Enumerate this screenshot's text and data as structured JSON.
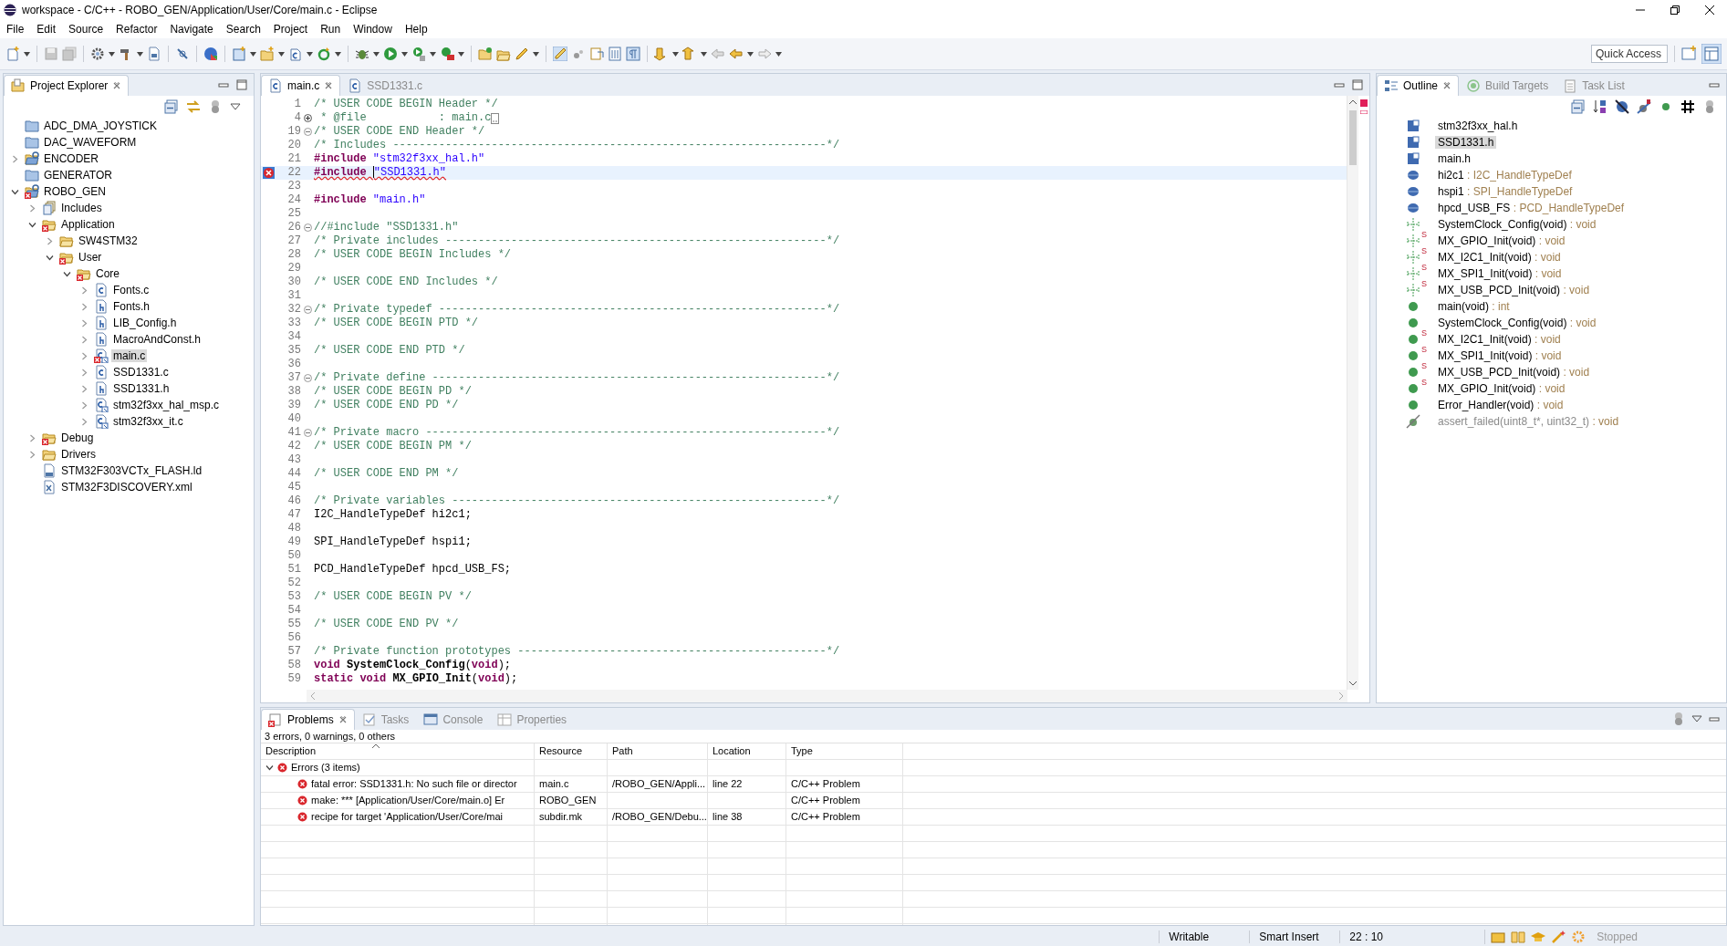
{
  "window": {
    "title": "workspace - C/C++ - ROBO_GEN/Application/User/Core/main.c - Eclipse"
  },
  "menu": [
    "File",
    "Edit",
    "Source",
    "Refactor",
    "Navigate",
    "Search",
    "Project",
    "Run",
    "Window",
    "Help"
  ],
  "toolbar": {
    "quick_access": {
      "placeholder": "Quick Access"
    }
  },
  "project_explorer": {
    "tabs": [
      {
        "label": "Project Explorer",
        "kind": "explorer",
        "selected": true,
        "closable": true
      }
    ],
    "tree": [
      {
        "label": "ADC_DMA_JOYSTICK",
        "kind": "closed-project",
        "error": false,
        "selected": false
      },
      {
        "label": "DAC_WAVEFORM",
        "kind": "closed-project",
        "error": false,
        "selected": false
      },
      {
        "label": "ENCODER",
        "kind": "project",
        "expanded": false,
        "error": false,
        "selected": false
      },
      {
        "label": "GENERATOR",
        "kind": "closed-project",
        "error": false,
        "selected": false
      },
      {
        "label": "ROBO_GEN",
        "kind": "project",
        "expanded": true,
        "error": true,
        "selected": false,
        "children": [
          {
            "label": "Includes",
            "kind": "includes",
            "expanded": false,
            "error": false,
            "selected": false
          },
          {
            "label": "Application",
            "kind": "folder",
            "expanded": true,
            "error": true,
            "selected": false,
            "children": [
              {
                "label": "SW4STM32",
                "kind": "folder",
                "expanded": false,
                "error": false,
                "selected": false
              },
              {
                "label": "User",
                "kind": "folder",
                "expanded": true,
                "error": true,
                "selected": false,
                "children": [
                  {
                    "label": "Core",
                    "kind": "folder",
                    "expanded": true,
                    "error": true,
                    "selected": false,
                    "children": [
                      {
                        "label": "Fonts.c",
                        "kind": "c-file",
                        "expanded": false,
                        "error": false,
                        "selected": false
                      },
                      {
                        "label": "Fonts.h",
                        "kind": "h-file",
                        "expanded": false,
                        "error": false,
                        "selected": false
                      },
                      {
                        "label": "LIB_Config.h",
                        "kind": "h-file",
                        "expanded": false,
                        "error": false,
                        "selected": false
                      },
                      {
                        "label": "MacroAndConst.h",
                        "kind": "h-file",
                        "expanded": false,
                        "error": false,
                        "selected": false
                      },
                      {
                        "label": "main.c",
                        "kind": "c-file-linked",
                        "expanded": false,
                        "error": true,
                        "selected": true
                      },
                      {
                        "label": "SSD1331.c",
                        "kind": "c-file",
                        "expanded": false,
                        "error": false,
                        "selected": false
                      },
                      {
                        "label": "SSD1331.h",
                        "kind": "h-file",
                        "expanded": false,
                        "error": false,
                        "selected": false
                      },
                      {
                        "label": "stm32f3xx_hal_msp.c",
                        "kind": "c-file-linked",
                        "expanded": false,
                        "error": false,
                        "selected": false
                      },
                      {
                        "label": "stm32f3xx_it.c",
                        "kind": "c-file-linked",
                        "expanded": false,
                        "error": false,
                        "selected": false
                      }
                    ]
                  }
                ]
              }
            ]
          },
          {
            "label": "Debug",
            "kind": "folder",
            "expanded": false,
            "error": true,
            "selected": false
          },
          {
            "label": "Drivers",
            "kind": "folder",
            "expanded": false,
            "error": false,
            "selected": false
          },
          {
            "label": "STM32F303VCTx_FLASH.ld",
            "kind": "ld-file",
            "error": false,
            "selected": false
          },
          {
            "label": "STM32F3DISCOVERY.xml",
            "kind": "xml-file",
            "error": false,
            "selected": false
          }
        ]
      }
    ]
  },
  "editor": {
    "tabs": [
      {
        "label": "main.c",
        "kind": "c-file",
        "selected": true,
        "closable": true
      },
      {
        "label": "SSD1331.c",
        "kind": "c-file",
        "selected": false,
        "closable": false
      }
    ],
    "lines": [
      {
        "num": "1",
        "foldable": false,
        "folded": false,
        "current": false,
        "error": false,
        "parts": [
          {
            "kind": "comment",
            "text": "/* USER CODE BEGIN Header */"
          }
        ]
      },
      {
        "num": "4",
        "foldable": true,
        "folded": true,
        "current": false,
        "error": false,
        "parts": [
          {
            "kind": "comment",
            "text": " * @file           : main.c"
          }
        ]
      },
      {
        "num": "19",
        "foldable": true,
        "folded": false,
        "current": false,
        "error": false,
        "parts": [
          {
            "kind": "comment",
            "text": "/* USER CODE END Header */"
          }
        ]
      },
      {
        "num": "20",
        "foldable": false,
        "folded": false,
        "current": false,
        "error": false,
        "parts": [
          {
            "kind": "comment",
            "text": "/* Includes ------------------------------------------------------------------*/"
          }
        ]
      },
      {
        "num": "21",
        "foldable": false,
        "folded": false,
        "current": false,
        "error": false,
        "parts": [
          {
            "kind": "keyword",
            "text": "#include "
          },
          {
            "kind": "string",
            "text": "\"stm32f3xx_hal.h\""
          }
        ]
      },
      {
        "num": "22",
        "foldable": false,
        "folded": false,
        "current": true,
        "error": true,
        "parts": [
          {
            "kind": "keyword",
            "text": "#include "
          },
          {
            "kind": "string",
            "text": "\"SSD1331.h\""
          }
        ]
      },
      {
        "num": "23",
        "foldable": false,
        "folded": false,
        "current": false,
        "error": false
      },
      {
        "num": "24",
        "foldable": false,
        "folded": false,
        "current": false,
        "error": false,
        "parts": [
          {
            "kind": "keyword",
            "text": "#include "
          },
          {
            "kind": "string",
            "text": "\"main.h\""
          }
        ]
      },
      {
        "num": "25",
        "foldable": false,
        "folded": false,
        "current": false,
        "error": false
      },
      {
        "num": "26",
        "foldable": true,
        "folded": false,
        "current": false,
        "error": false,
        "parts": [
          {
            "kind": "comment",
            "text": "//#include \"SSD1331.h\""
          }
        ]
      },
      {
        "num": "27",
        "foldable": false,
        "folded": false,
        "current": false,
        "error": false,
        "parts": [
          {
            "kind": "comment",
            "text": "/* Private includes ----------------------------------------------------------*/"
          }
        ]
      },
      {
        "num": "28",
        "foldable": false,
        "folded": false,
        "current": false,
        "error": false,
        "parts": [
          {
            "kind": "comment",
            "text": "/* USER CODE BEGIN Includes */"
          }
        ]
      },
      {
        "num": "29",
        "foldable": false,
        "folded": false,
        "current": false,
        "error": false
      },
      {
        "num": "30",
        "foldable": false,
        "folded": false,
        "current": false,
        "error": false,
        "parts": [
          {
            "kind": "comment",
            "text": "/* USER CODE END Includes */"
          }
        ]
      },
      {
        "num": "31",
        "foldable": false,
        "folded": false,
        "current": false,
        "error": false
      },
      {
        "num": "32",
        "foldable": true,
        "folded": false,
        "current": false,
        "error": false,
        "parts": [
          {
            "kind": "comment",
            "text": "/* Private typedef -----------------------------------------------------------*/"
          }
        ]
      },
      {
        "num": "33",
        "foldable": false,
        "folded": false,
        "current": false,
        "error": false,
        "parts": [
          {
            "kind": "comment",
            "text": "/* USER CODE BEGIN PTD */"
          }
        ]
      },
      {
        "num": "34",
        "foldable": false,
        "folded": false,
        "current": false,
        "error": false
      },
      {
        "num": "35",
        "foldable": false,
        "folded": false,
        "current": false,
        "error": false,
        "parts": [
          {
            "kind": "comment",
            "text": "/* USER CODE END PTD */"
          }
        ]
      },
      {
        "num": "36",
        "foldable": false,
        "folded": false,
        "current": false,
        "error": false
      },
      {
        "num": "37",
        "foldable": true,
        "folded": false,
        "current": false,
        "error": false,
        "parts": [
          {
            "kind": "comment",
            "text": "/* Private define ------------------------------------------------------------*/"
          }
        ]
      },
      {
        "num": "38",
        "foldable": false,
        "folded": false,
        "current": false,
        "error": false,
        "parts": [
          {
            "kind": "comment",
            "text": "/* USER CODE BEGIN PD */"
          }
        ]
      },
      {
        "num": "39",
        "foldable": false,
        "folded": false,
        "current": false,
        "error": false,
        "parts": [
          {
            "kind": "comment",
            "text": "/* USER CODE END PD */"
          }
        ]
      },
      {
        "num": "40",
        "foldable": false,
        "folded": false,
        "current": false,
        "error": false
      },
      {
        "num": "41",
        "foldable": true,
        "folded": false,
        "current": false,
        "error": false,
        "parts": [
          {
            "kind": "comment",
            "text": "/* Private macro -------------------------------------------------------------*/"
          }
        ]
      },
      {
        "num": "42",
        "foldable": false,
        "folded": false,
        "current": false,
        "error": false,
        "parts": [
          {
            "kind": "comment",
            "text": "/* USER CODE BEGIN PM */"
          }
        ]
      },
      {
        "num": "43",
        "foldable": false,
        "folded": false,
        "current": false,
        "error": false
      },
      {
        "num": "44",
        "foldable": false,
        "folded": false,
        "current": false,
        "error": false,
        "parts": [
          {
            "kind": "comment",
            "text": "/* USER CODE END PM */"
          }
        ]
      },
      {
        "num": "45",
        "foldable": false,
        "folded": false,
        "current": false,
        "error": false
      },
      {
        "num": "46",
        "foldable": false,
        "folded": false,
        "current": false,
        "error": false,
        "parts": [
          {
            "kind": "comment",
            "text": "/* Private variables ---------------------------------------------------------*/"
          }
        ]
      },
      {
        "num": "47",
        "foldable": false,
        "folded": false,
        "current": false,
        "error": false,
        "parts": [
          {
            "kind": "plain",
            "text": "I2C_HandleTypeDef hi2c1;"
          }
        ]
      },
      {
        "num": "48",
        "foldable": false,
        "folded": false,
        "current": false,
        "error": false
      },
      {
        "num": "49",
        "foldable": false,
        "folded": false,
        "current": false,
        "error": false,
        "parts": [
          {
            "kind": "plain",
            "text": "SPI_HandleTypeDef hspi1;"
          }
        ]
      },
      {
        "num": "50",
        "foldable": false,
        "folded": false,
        "current": false,
        "error": false
      },
      {
        "num": "51",
        "foldable": false,
        "folded": false,
        "current": false,
        "error": false,
        "parts": [
          {
            "kind": "plain",
            "text": "PCD_HandleTypeDef hpcd_USB_FS;"
          }
        ]
      },
      {
        "num": "52",
        "foldable": false,
        "folded": false,
        "current": false,
        "error": false
      },
      {
        "num": "53",
        "foldable": false,
        "folded": false,
        "current": false,
        "error": false,
        "parts": [
          {
            "kind": "comment",
            "text": "/* USER CODE BEGIN PV */"
          }
        ]
      },
      {
        "num": "54",
        "foldable": false,
        "folded": false,
        "current": false,
        "error": false
      },
      {
        "num": "55",
        "foldable": false,
        "folded": false,
        "current": false,
        "error": false,
        "parts": [
          {
            "kind": "comment",
            "text": "/* USER CODE END PV */"
          }
        ]
      },
      {
        "num": "56",
        "foldable": false,
        "folded": false,
        "current": false,
        "error": false
      },
      {
        "num": "57",
        "foldable": false,
        "folded": false,
        "current": false,
        "error": false,
        "parts": [
          {
            "kind": "comment",
            "text": "/* Private function prototypes -----------------------------------------------*/"
          }
        ]
      },
      {
        "num": "58",
        "foldable": false,
        "folded": false,
        "current": false,
        "error": false,
        "parts": [
          {
            "kind": "keyword",
            "text": "void "
          },
          {
            "kind": "bold",
            "text": "SystemClock_Config"
          },
          {
            "kind": "plain",
            "text": "("
          },
          {
            "kind": "keyword",
            "text": "void"
          },
          {
            "kind": "plain",
            "text": ");"
          }
        ]
      },
      {
        "num": "59",
        "foldable": false,
        "folded": false,
        "current": false,
        "error": false,
        "parts": [
          {
            "kind": "keyword",
            "text": "static void "
          },
          {
            "kind": "bold",
            "text": "MX_GPIO_Init"
          },
          {
            "kind": "plain",
            "text": "("
          },
          {
            "kind": "keyword",
            "text": "void"
          },
          {
            "kind": "plain",
            "text": ");"
          }
        ]
      }
    ]
  },
  "outline": {
    "tabs": [
      {
        "label": "Outline",
        "kind": "outline",
        "selected": true,
        "closable": true
      },
      {
        "label": "Build Targets",
        "kind": "build-targets",
        "selected": false,
        "closable": false
      },
      {
        "label": "Task List",
        "kind": "task-list",
        "selected": false,
        "closable": false
      }
    ],
    "items": [
      {
        "kind": "include",
        "name": "stm32f3xx_hal.h",
        "selected": false
      },
      {
        "kind": "include",
        "name": "SSD1331.h",
        "selected": true
      },
      {
        "kind": "include",
        "name": "main.h",
        "selected": false
      },
      {
        "kind": "variable",
        "name": "hi2c1",
        "type": ": I2C_HandleTypeDef",
        "selected": false
      },
      {
        "kind": "variable",
        "name": "hspi1",
        "type": ": SPI_HandleTypeDef",
        "selected": false
      },
      {
        "kind": "variable",
        "name": "hpcd_USB_FS",
        "type": ": PCD_HandleTypeDef",
        "selected": false
      },
      {
        "kind": "declaration",
        "name": "SystemClock_Config(void)",
        "type": ": void",
        "selected": false
      },
      {
        "kind": "declaration",
        "badge": "S",
        "name": "MX_GPIO_Init(void)",
        "type": ": void",
        "selected": false
      },
      {
        "kind": "declaration",
        "badge": "S",
        "name": "MX_I2C1_Init(void)",
        "type": ": void",
        "selected": false
      },
      {
        "kind": "declaration",
        "badge": "S",
        "name": "MX_SPI1_Init(void)",
        "type": ": void",
        "selected": false
      },
      {
        "kind": "declaration",
        "badge": "S",
        "name": "MX_USB_PCD_Init(void)",
        "type": ": void",
        "selected": false
      },
      {
        "kind": "function",
        "name": "main(void)",
        "type": ": int",
        "selected": false
      },
      {
        "kind": "function",
        "name": "SystemClock_Config(void)",
        "type": ": void",
        "selected": false
      },
      {
        "kind": "function",
        "badge": "S",
        "name": "MX_I2C1_Init(void)",
        "type": ": void",
        "selected": false
      },
      {
        "kind": "function",
        "badge": "S",
        "name": "MX_SPI1_Init(void)",
        "type": ": void",
        "selected": false
      },
      {
        "kind": "function",
        "badge": "S",
        "name": "MX_USB_PCD_Init(void)",
        "type": ": void",
        "selected": false
      },
      {
        "kind": "function",
        "badge": "S",
        "name": "MX_GPIO_Init(void)",
        "type": ": void",
        "selected": false
      },
      {
        "kind": "function",
        "name": "Error_Handler(void)",
        "type": ": void",
        "selected": false
      },
      {
        "kind": "inactive",
        "name": "assert_failed(uint8_t*, uint32_t)",
        "type": ": void",
        "selected": false
      }
    ]
  },
  "problems": {
    "tabs": [
      {
        "label": "Problems",
        "kind": "problems",
        "selected": true,
        "closable": true
      },
      {
        "label": "Tasks",
        "kind": "tasks",
        "selected": false,
        "closable": false
      },
      {
        "label": "Console",
        "kind": "console",
        "selected": false,
        "closable": false
      },
      {
        "label": "Properties",
        "kind": "properties",
        "selected": false,
        "closable": false
      }
    ],
    "summary": "3 errors, 0 warnings, 0 others",
    "columns": [
      "Description",
      "Resource",
      "Path",
      "Location",
      "Type"
    ],
    "groups": [
      {
        "label": "Errors (3 items)",
        "expanded": true,
        "rows": [
          {
            "kind": "error",
            "description": "fatal error: SSD1331.h: No such file or director",
            "resource": "main.c",
            "path": "/ROBO_GEN/Appli...",
            "location": "line 22",
            "type": "C/C++ Problem"
          },
          {
            "kind": "error",
            "description": "make: *** [Application/User/Core/main.o] Er",
            "resource": "ROBO_GEN",
            "type": "C/C++ Problem"
          },
          {
            "kind": "error",
            "description": "recipe for target 'Application/User/Core/mai",
            "resource": "subdir.mk",
            "path": "/ROBO_GEN/Debu...",
            "location": "line 38",
            "type": "C/C++ Problem"
          }
        ]
      }
    ]
  },
  "status_bar": {
    "fields": [
      "Writable",
      "Smart Insert",
      "22 : 10"
    ],
    "launch_status": "Stopped"
  }
}
